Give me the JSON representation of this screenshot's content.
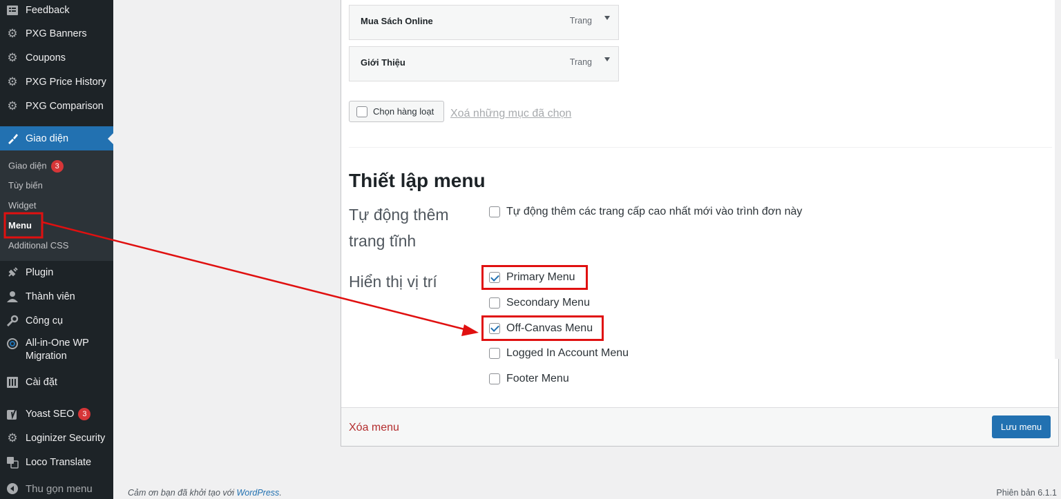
{
  "sidebar": {
    "items": [
      {
        "label": "Feedback",
        "icon": "feedback-icon"
      },
      {
        "label": "PXG Banners",
        "icon": "gear-icon"
      },
      {
        "label": "Coupons",
        "icon": "gear-icon"
      },
      {
        "label": "PXG Price History",
        "icon": "gear-icon"
      },
      {
        "label": "PXG Comparison",
        "icon": "gear-icon"
      },
      {
        "label": "Giao diện",
        "icon": "paintbrush-icon"
      },
      {
        "label": "Plugin",
        "icon": "plugin-icon"
      },
      {
        "label": "Thành viên",
        "icon": "user-icon"
      },
      {
        "label": "Công cụ",
        "icon": "wrench-icon"
      },
      {
        "label": "All-in-One WP",
        "label2": "Migration",
        "icon": "migration-icon"
      },
      {
        "label": "Cài đặt",
        "icon": "settings-icon"
      },
      {
        "label": "Yoast SEO",
        "icon": "yoast-icon",
        "badge": "3"
      },
      {
        "label": "Loginizer Security",
        "icon": "gear-icon"
      },
      {
        "label": "Loco Translate",
        "icon": "translate-icon"
      }
    ],
    "submenu": [
      {
        "label": "Giao diện",
        "badge": "3"
      },
      {
        "label": "Tùy biến"
      },
      {
        "label": "Widget"
      },
      {
        "label": "Menu"
      },
      {
        "label": "Additional CSS"
      }
    ],
    "collapse_label": "Thu gọn menu"
  },
  "menu_items": [
    {
      "title": "Mua Sách Online",
      "type": "Trang"
    },
    {
      "title": "Giới Thiệu",
      "type": "Trang"
    }
  ],
  "bulk": {
    "select_label": "Chọn hàng loạt",
    "remove_label": "Xoá những mục đã chọn"
  },
  "settings": {
    "title": "Thiết lập menu",
    "auto_add_label": "Tự động thêm trang tĩnh",
    "auto_add_option": "Tự động thêm các trang cấp cao nhất mới vào trình đơn này",
    "display_label": "Hiển thị vị trí",
    "locations": [
      {
        "label": "Primary Menu",
        "checked": true
      },
      {
        "label": "Secondary Menu",
        "checked": false
      },
      {
        "label": "Off-Canvas Menu",
        "checked": true
      },
      {
        "label": "Logged In Account Menu",
        "checked": false
      },
      {
        "label": "Footer Menu",
        "checked": false
      }
    ]
  },
  "actions": {
    "delete_label": "Xóa menu",
    "save_label": "Lưu menu"
  },
  "footer": {
    "thanks_text": "Cảm ơn bạn đã khởi tạo với",
    "thanks_link": "WordPress",
    "thanks_end": ".",
    "version": "Phiên bản 6.1.1"
  },
  "colors": {
    "sidebar_bg": "#1d2327",
    "accent": "#2271b1",
    "annotation_red": "#e01010",
    "danger": "#b32d2e"
  }
}
